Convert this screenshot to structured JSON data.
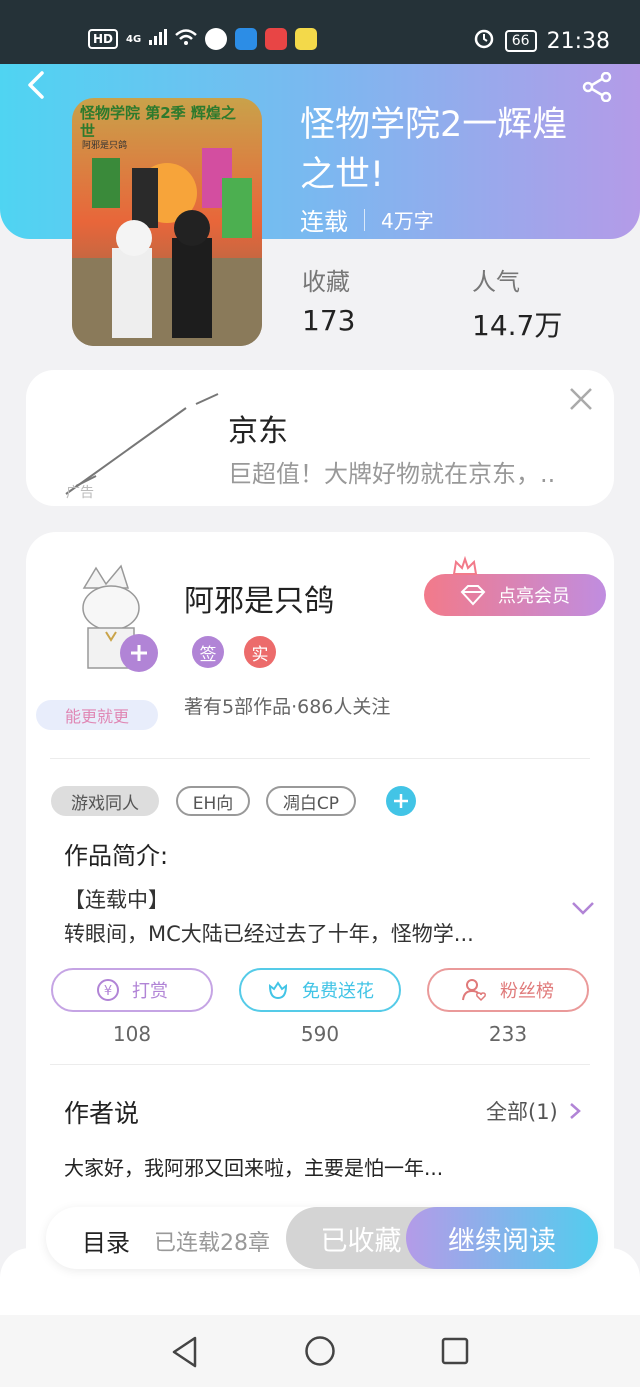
{
  "status_bar": {
    "left_badge": "HD",
    "network": "4G",
    "battery": "66",
    "time": "21:38"
  },
  "book": {
    "title": "怪物学院2一辉煌之世!",
    "cover_text": "怪物学院 第2季 辉煌之世",
    "cover_author": "阿邪是只鸽",
    "status": "连载",
    "word_count": "4万字",
    "favorites_label": "收藏",
    "favorites_value": "173",
    "popularity_label": "人气",
    "popularity_value": "14.7万"
  },
  "ad": {
    "title": "京东",
    "subtitle": "巨超值！大牌好物就在京东，..",
    "badge": "广告"
  },
  "author": {
    "name": "阿邪是只鸽",
    "badge_sign": "签",
    "badge_real": "实",
    "stats": "著有5部作品·686人关注",
    "sticker": "能更就更",
    "vip_button": "点亮会员"
  },
  "tags": [
    "游戏同人",
    "EH向",
    "凋白CP"
  ],
  "intro": {
    "heading": "作品简介:",
    "line1": "【连载中】",
    "line2": "转眼间，MC大陆已经过去了十年，怪物学..."
  },
  "actions": [
    {
      "label": "打赏",
      "count": "108",
      "color": "#b184d6"
    },
    {
      "label": "免费送花",
      "count": "590",
      "color": "#42c4e6"
    },
    {
      "label": "粉丝榜",
      "count": "233",
      "color": "#e07a7a"
    }
  ],
  "author_says": {
    "heading": "作者说",
    "all_link": "全部(1)",
    "text": "大家好，我阿邪又回来啦，主要是怕一年..."
  },
  "bottom_bar": {
    "toc": "目录",
    "chapters": "已连载28章",
    "collected": "已收藏",
    "continue": "继续阅读"
  },
  "colors": {
    "header_start": "#4fd4f2",
    "header_end": "#b49be8",
    "purple": "#a98ae6",
    "cyan": "#42c4e6",
    "red": "#e86d74"
  }
}
